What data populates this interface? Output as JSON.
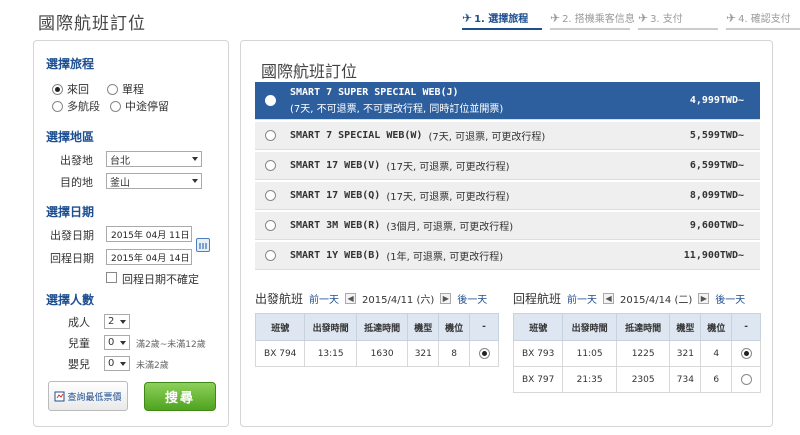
{
  "page": {
    "title": "國際航班訂位",
    "steps": [
      {
        "label": "1. 選擇旅程",
        "active": true
      },
      {
        "label": "2. 搭機乘客信息",
        "active": false
      },
      {
        "label": "3. 支付",
        "active": false
      },
      {
        "label": "4. 確認支付",
        "active": false
      }
    ]
  },
  "sidebar": {
    "trip_type": {
      "title": "選擇旅程",
      "options": [
        {
          "label": "來回",
          "selected": true
        },
        {
          "label": "單程",
          "selected": false
        },
        {
          "label": "多航段",
          "selected": false
        },
        {
          "label": "中途停留",
          "selected": false
        }
      ]
    },
    "location": {
      "title": "選擇地區",
      "origin_label": "出發地",
      "origin_value": "台北",
      "dest_label": "目的地",
      "dest_value": "釜山"
    },
    "dates": {
      "title": "選擇日期",
      "depart_label": "出發日期",
      "depart_value": "2015年 04月 11日",
      "return_label": "回程日期",
      "return_value": "2015年 04月 14日",
      "unsure_label": "回程日期不確定"
    },
    "pax": {
      "title": "選擇人數",
      "adult_label": "成人",
      "adult_value": "2",
      "child_label": "兒童",
      "child_value": "0",
      "child_note": "滿2歲~未滿12歲",
      "infant_label": "嬰兒",
      "infant_value": "0",
      "infant_note": "未滿2歲"
    },
    "lowest_fare_button": "查詢最低票價",
    "search_button": "搜尋"
  },
  "main": {
    "title": "國際航班訂位",
    "fares": [
      {
        "name": "SMART 7 SUPER SPECIAL WEB(J)",
        "desc": "(7天, 不可退票, 不可更改行程, 同時訂位並開票)",
        "price": "4,999TWD~",
        "selected": true
      },
      {
        "name": "SMART 7 SPECIAL WEB(W)",
        "desc": "(7天, 可退票, 可更改行程)",
        "price": "5,599TWD~",
        "selected": false
      },
      {
        "name": "SMART 17 WEB(V)",
        "desc": "(17天, 可退票, 可更改行程)",
        "price": "6,599TWD~",
        "selected": false
      },
      {
        "name": "SMART 17 WEB(Q)",
        "desc": "(17天, 可退票, 可更改行程)",
        "price": "8,099TWD~",
        "selected": false
      },
      {
        "name": "SMART 3M WEB(R)",
        "desc": "(3個月, 可退票, 可更改行程)",
        "price": "9,600TWD~",
        "selected": false
      },
      {
        "name": "SMART 1Y WEB(B)",
        "desc": "(1年, 可退票, 可更改行程)",
        "price": "11,900TWD~",
        "selected": false
      }
    ],
    "outbound": {
      "title": "出發航班",
      "prev_label": "前一天",
      "date": "2015/4/11 (六)",
      "next_label": "後一天",
      "columns": [
        "班號",
        "出發時間",
        "抵達時間",
        "機型",
        "機位",
        "-"
      ],
      "rows": [
        {
          "flight": "BX 794",
          "dep": "13:15",
          "arr": "1630",
          "type": "321",
          "seats": "8",
          "selected": true
        }
      ]
    },
    "inbound": {
      "title": "回程航班",
      "prev_label": "前一天",
      "date": "2015/4/14 (二)",
      "next_label": "後一天",
      "columns": [
        "班號",
        "出發時間",
        "抵達時間",
        "機型",
        "機位",
        "-"
      ],
      "rows": [
        {
          "flight": "BX 793",
          "dep": "11:05",
          "arr": "1225",
          "type": "321",
          "seats": "4",
          "selected": true
        },
        {
          "flight": "BX 797",
          "dep": "21:35",
          "arr": "2305",
          "type": "734",
          "seats": "6",
          "selected": false
        }
      ]
    }
  }
}
